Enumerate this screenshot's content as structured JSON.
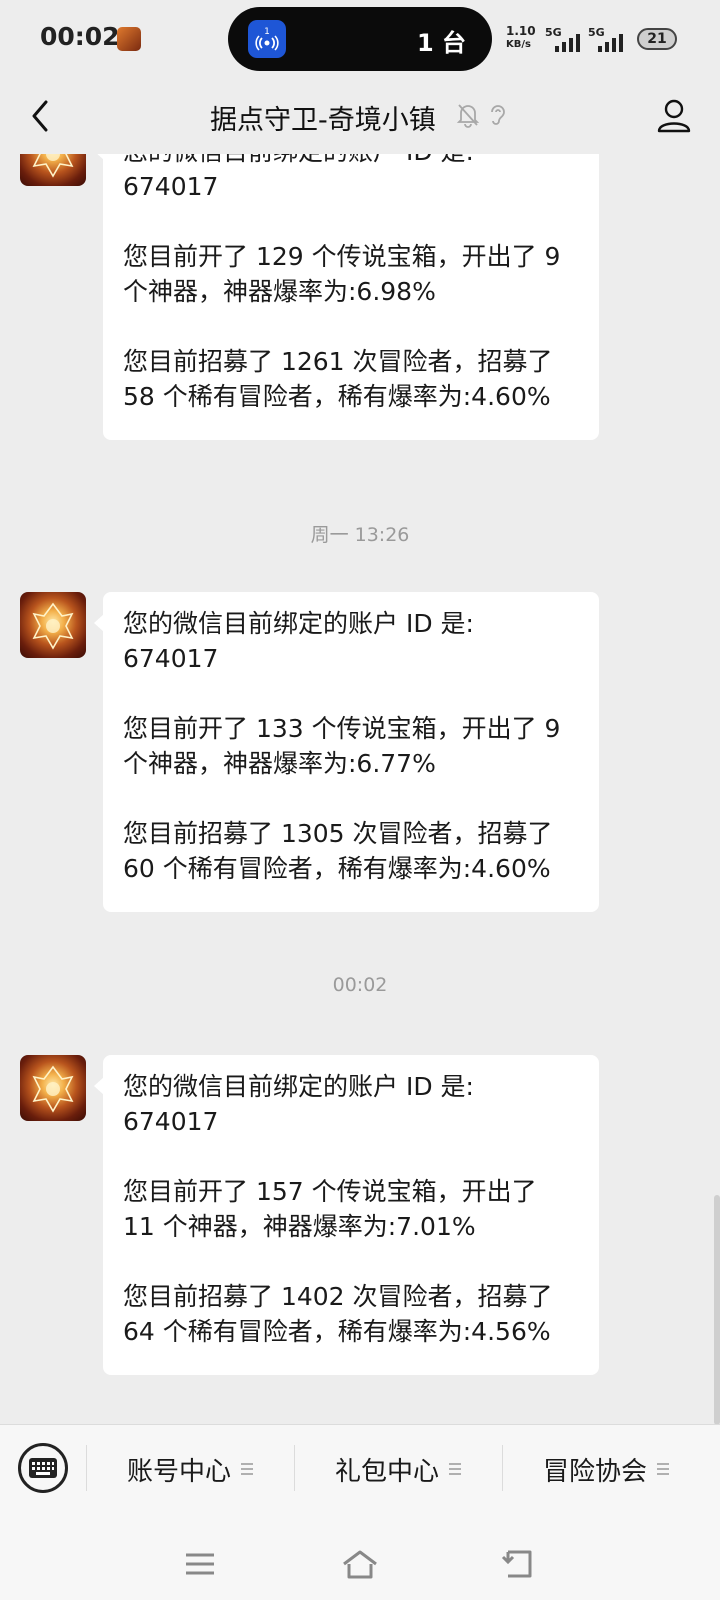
{
  "status_bar": {
    "time": "00:02",
    "island_badge": "1",
    "island_text": "1 台",
    "net_speed": "1.10",
    "net_unit": "KB/s",
    "sim1_label": "5G",
    "sim2_label": "5G",
    "battery": "21"
  },
  "header": {
    "title": "据点守卫-奇境小镇"
  },
  "messages": [
    {
      "line1": "您的微信目前绑定的账户 ID 是:",
      "line2": "674017",
      "line3": "您目前开了 129 个传说宝箱，开出了 9",
      "line4": "个神器，神器爆率为:6.98%",
      "line5": "您目前招募了 1261 次冒险者，招募了",
      "line6": "58 个稀有冒险者，稀有爆率为:4.60%"
    },
    {
      "line1": "您的微信目前绑定的账户 ID 是:",
      "line2": "674017",
      "line3": "您目前开了 133 个传说宝箱，开出了 9",
      "line4": "个神器，神器爆率为:6.77%",
      "line5": "您目前招募了 1305 次冒险者，招募了",
      "line6": "60 个稀有冒险者，稀有爆率为:4.60%"
    },
    {
      "line1": "您的微信目前绑定的账户 ID 是:",
      "line2": "674017",
      "line3": "您目前开了 157 个传说宝箱，开出了",
      "line4": "11 个神器，神器爆率为:7.01%",
      "line5": "您目前招募了 1402 次冒险者，招募了",
      "line6": "64 个稀有冒险者，稀有爆率为:4.56%"
    }
  ],
  "timestamps": [
    "周一 13:26",
    "00:02"
  ],
  "menu": {
    "items": [
      "账号中心",
      "礼包中心",
      "冒险协会"
    ]
  },
  "icons": {
    "back": "chevron-left-icon",
    "mute": "bell-off-icon",
    "ear": "ear-icon",
    "profile": "person-icon",
    "keyboard": "keyboard-icon"
  },
  "colors": {
    "background": "#ededed",
    "bubble": "#ffffff",
    "timestamp": "#9a9a9a",
    "island": "#0b0b0b",
    "island_icon": "#1e56d6"
  }
}
